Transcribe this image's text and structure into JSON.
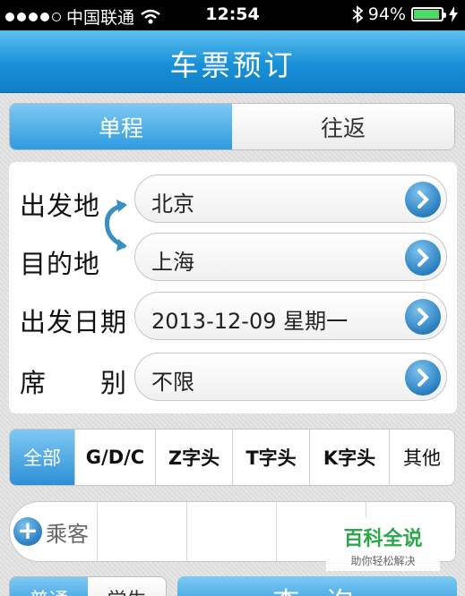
{
  "status_bar": {
    "carrier": "中国联通",
    "time": "12:54",
    "battery_percent": "94%",
    "battery_level": 0.94,
    "icons": [
      "signal-dots-icon",
      "wifi-icon",
      "bluetooth-icon",
      "battery-icon"
    ]
  },
  "nav": {
    "title": "车票预订"
  },
  "trip_type": {
    "one_way": "单程",
    "round_trip": "往返",
    "selected": "单程"
  },
  "form": {
    "from_label": "出发地",
    "from_value": "北京",
    "to_label": "目的地",
    "to_value": "上海",
    "date_label": "出发日期",
    "date_value": "2013-12-09 星期一",
    "seat_label": "席　　别",
    "seat_value": "不限"
  },
  "train_types": [
    "全部",
    "G/D/C",
    "Z字头",
    "T字头",
    "K字头",
    "其他"
  ],
  "train_type_selected": "全部",
  "passenger": {
    "add_label": "乘客"
  },
  "bottom": {
    "ticket_normal": "普通",
    "ticket_student": "学生",
    "query_label": "查 询"
  },
  "watermark": {
    "title": "百科全说",
    "subtitle": "助你轻松解决"
  },
  "colors": {
    "accent": "#2e9be0",
    "nav": "#1890d8",
    "battery": "#4cd964"
  }
}
